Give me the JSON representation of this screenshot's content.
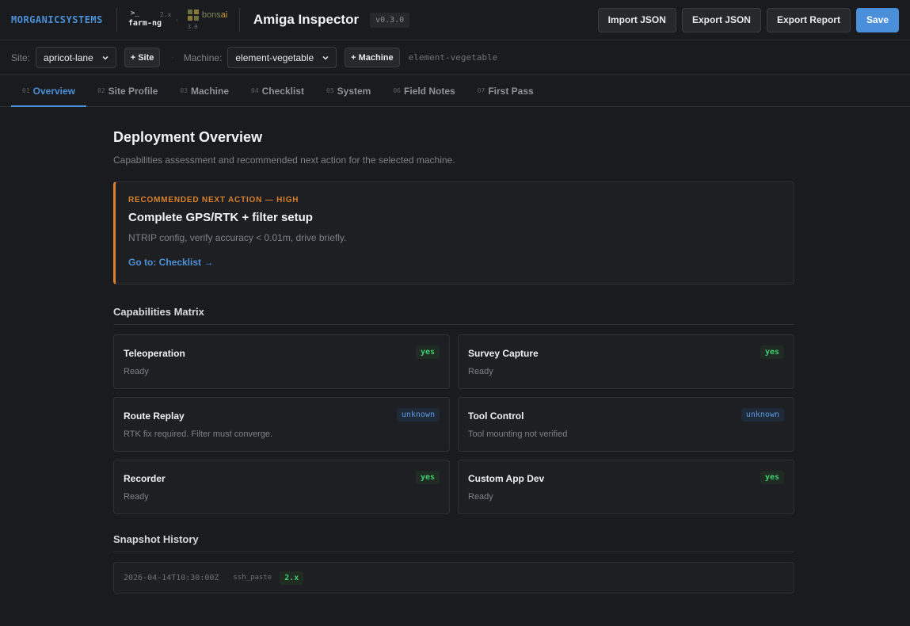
{
  "header": {
    "brand": "MORGANICSYSTEMS",
    "farmng": {
      "prompt": ">_",
      "version": "2.x",
      "name": "farm-ng"
    },
    "bonsai": {
      "name_part1": "bons",
      "name_part2": "ai",
      "version": "3.0"
    },
    "app_title": "Amiga Inspector",
    "version": "v0.3.0",
    "buttons": {
      "import": "Import JSON",
      "export": "Export JSON",
      "report": "Export Report",
      "save": "Save"
    }
  },
  "sitebar": {
    "site_label": "Site:",
    "site_value": "apricot-lane",
    "add_site": "+ Site",
    "machine_label": "Machine:",
    "machine_value": "element-vegetable",
    "add_machine": "+ Machine",
    "machine_id": "element-vegetable"
  },
  "tabs": [
    {
      "num": "01",
      "label": "Overview"
    },
    {
      "num": "02",
      "label": "Site Profile"
    },
    {
      "num": "03",
      "label": "Machine"
    },
    {
      "num": "04",
      "label": "Checklist"
    },
    {
      "num": "05",
      "label": "System"
    },
    {
      "num": "06",
      "label": "Field Notes"
    },
    {
      "num": "07",
      "label": "First Pass"
    }
  ],
  "overview": {
    "title": "Deployment Overview",
    "subtitle": "Capabilities assessment and recommended next action for the selected machine.",
    "recommendation": {
      "kicker": "RECOMMENDED NEXT ACTION — HIGH",
      "title": "Complete GPS/RTK + filter setup",
      "description": "NTRIP config, verify accuracy < 0.01m, drive briefly.",
      "link": "Go to: Checklist →"
    },
    "capabilities_title": "Capabilities Matrix",
    "capabilities": [
      {
        "name": "Teleoperation",
        "note": "Ready",
        "status": "yes"
      },
      {
        "name": "Survey Capture",
        "note": "Ready",
        "status": "yes"
      },
      {
        "name": "Route Replay",
        "note": "RTK fix required. Filter must converge.",
        "status": "unknown"
      },
      {
        "name": "Tool Control",
        "note": "Tool mounting not verified",
        "status": "unknown"
      },
      {
        "name": "Recorder",
        "note": "Ready",
        "status": "yes"
      },
      {
        "name": "Custom App Dev",
        "note": "Ready",
        "status": "yes"
      }
    ],
    "snapshot_title": "Snapshot History",
    "snapshots": [
      {
        "timestamp": "2026-04-14T10:30:00Z",
        "source": "ssh_paste",
        "version": "2.x"
      }
    ]
  },
  "colors": {
    "accent": "#4a90d9",
    "warning": "#d9822b",
    "success": "#3ecf6e",
    "background": "#1a1b1e"
  }
}
